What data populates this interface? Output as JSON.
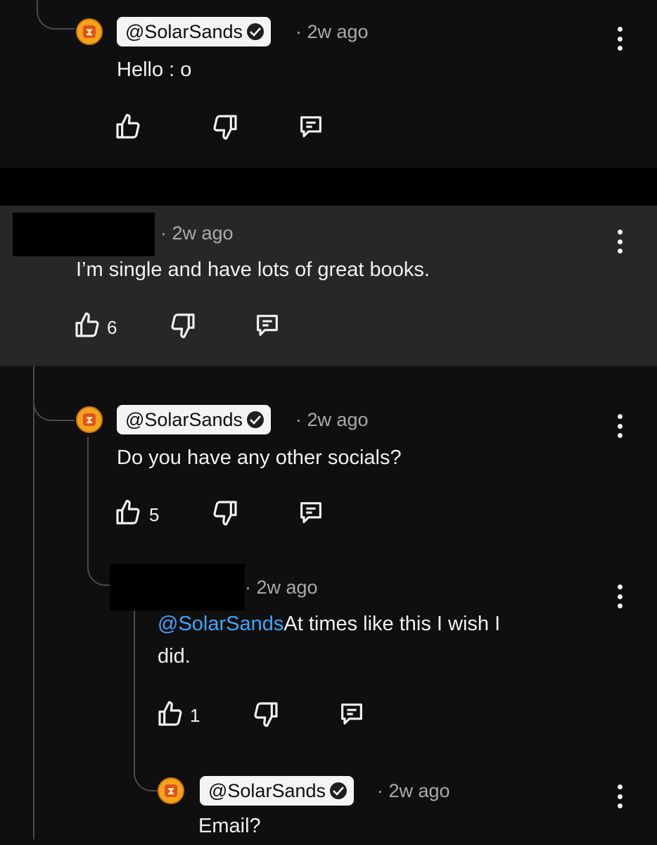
{
  "comments": [
    {
      "handle": "@SolarSands",
      "time": "· 2w ago",
      "text": "Hello : o",
      "likes": ""
    },
    {
      "handle": "",
      "time": "· 2w ago",
      "text": "I’m single and have lots of great books.",
      "likes": "6"
    },
    {
      "handle": "@SolarSands",
      "time": "· 2w ago",
      "text": "Do you have any other socials?",
      "likes": "5"
    },
    {
      "handle": "",
      "time": "· 2w ago",
      "mention": "@SolarSands",
      "text_line1": "At times like this I wish I",
      "text_line2": "did.",
      "likes": "1"
    },
    {
      "handle": "@SolarSands",
      "time": "· 2w ago",
      "text": "Email?",
      "likes": ""
    }
  ],
  "icons": {
    "like": "thumbs-up-icon",
    "dislike": "thumbs-down-icon",
    "reply": "reply-icon",
    "menu": "more-vert-icon",
    "verified": "verified-check-icon",
    "avatar": "hourglass-avatar"
  },
  "colors": {
    "background": "#0f0f0f",
    "highlight": "#272727",
    "mention": "#3ea6ff",
    "avatar": "#f5a31a"
  }
}
